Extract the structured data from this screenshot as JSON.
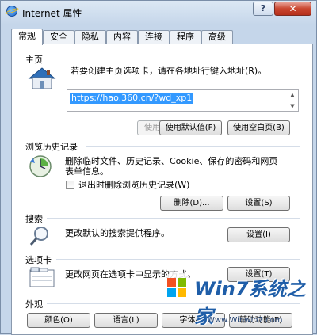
{
  "window": {
    "title": "Internet 属性",
    "help_glyph": "?",
    "close_glyph": "✕"
  },
  "tabs": [
    "常规",
    "安全",
    "隐私",
    "内容",
    "连接",
    "程序",
    "高级"
  ],
  "home": {
    "label": "主页",
    "instruction": "若要创建主页选项卡，请在各地址行键入地址(R)。",
    "url": "https://hao.360.cn/?wd_xp1",
    "btn_current": "使用当前页(C)",
    "btn_default": "使用默认值(F)",
    "btn_blank": "使用空白页(B)"
  },
  "history": {
    "label": "浏览历史记录",
    "description_line1": "删除临时文件、历史记录、Cookie、保存的密码和网页",
    "description_line2": "表单信息。",
    "checkbox_label": "退出时删除浏览历史记录(W)",
    "btn_delete": "删除(D)...",
    "btn_settings": "设置(S)"
  },
  "search": {
    "label": "搜索",
    "description": "更改默认的搜索提供程序。",
    "btn_settings": "设置(I)"
  },
  "tabs_section": {
    "label": "选项卡",
    "description": "更改网页在选项卡中显示的方式。",
    "btn_settings": "设置(T)"
  },
  "appearance": {
    "label": "外观",
    "btn_colors": "颜色(O)",
    "btn_languages": "语言(L)",
    "btn_fonts": "字体(N)",
    "btn_accessibility": "辅助功能(E)"
  },
  "watermark": {
    "brand": "Win7系统之家",
    "url": "Www.Winwin7.com"
  }
}
